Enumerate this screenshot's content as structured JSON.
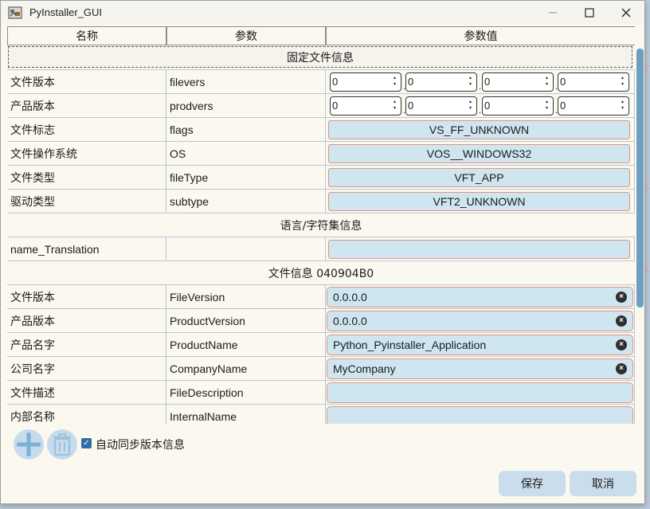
{
  "window": {
    "title": "PyInstaller_GUI"
  },
  "table": {
    "headers": [
      "名称",
      "参数",
      "参数值"
    ],
    "section_fixed": "固定文件信息",
    "section_lang": "语言/字符集信息",
    "section_file": "文件信息 040904B0",
    "fixed_rows": [
      {
        "name": "文件版本",
        "param": "filevers",
        "type": "spin",
        "values": [
          "0",
          "0",
          "0",
          "0"
        ]
      },
      {
        "name": "产品版本",
        "param": "prodvers",
        "type": "spin",
        "values": [
          "0",
          "0",
          "0",
          "0"
        ]
      },
      {
        "name": "文件标志",
        "param": "flags",
        "type": "combo",
        "value": "VS_FF_UNKNOWN"
      },
      {
        "name": "文件操作系统",
        "param": "OS",
        "type": "combo",
        "value": "VOS__WINDOWS32"
      },
      {
        "name": "文件类型",
        "param": "fileType",
        "type": "combo",
        "value": "VFT_APP"
      },
      {
        "name": "驱动类型",
        "param": "subtype",
        "type": "combo",
        "value": "VFT2_UNKNOWN"
      }
    ],
    "lang_rows": [
      {
        "name": "name_Translation",
        "param": "",
        "value": ""
      }
    ],
    "file_rows": [
      {
        "name": "文件版本",
        "param": "FileVersion",
        "value": "0.0.0.0"
      },
      {
        "name": "产品版本",
        "param": "ProductVersion",
        "value": "0.0.0.0"
      },
      {
        "name": "产品名字",
        "param": "ProductName",
        "value": "Python_Pyinstaller_Application"
      },
      {
        "name": "公司名字",
        "param": "CompanyName",
        "value": "MyCompany"
      },
      {
        "name": "文件描述",
        "param": "FileDescription",
        "value": ""
      },
      {
        "name": "内部名称",
        "param": "InternalName",
        "value": ""
      }
    ]
  },
  "footer": {
    "auto_sync_label": "自动同步版本信息",
    "auto_sync_checked": true,
    "save_label": "保存",
    "cancel_label": "取消"
  },
  "icons": {
    "app": "pyinstaller-app-icon",
    "add": "add-icon",
    "delete": "trash-icon",
    "clear": "clear-icon",
    "minimize": "minimize-icon",
    "maximize": "maximize-icon",
    "close": "close-icon"
  },
  "colors": {
    "field_bg": "#cfe6f1",
    "field_border": "#e0937e",
    "scroll_thumb": "#6f9fc0",
    "button_bg": "#c9ddec"
  }
}
